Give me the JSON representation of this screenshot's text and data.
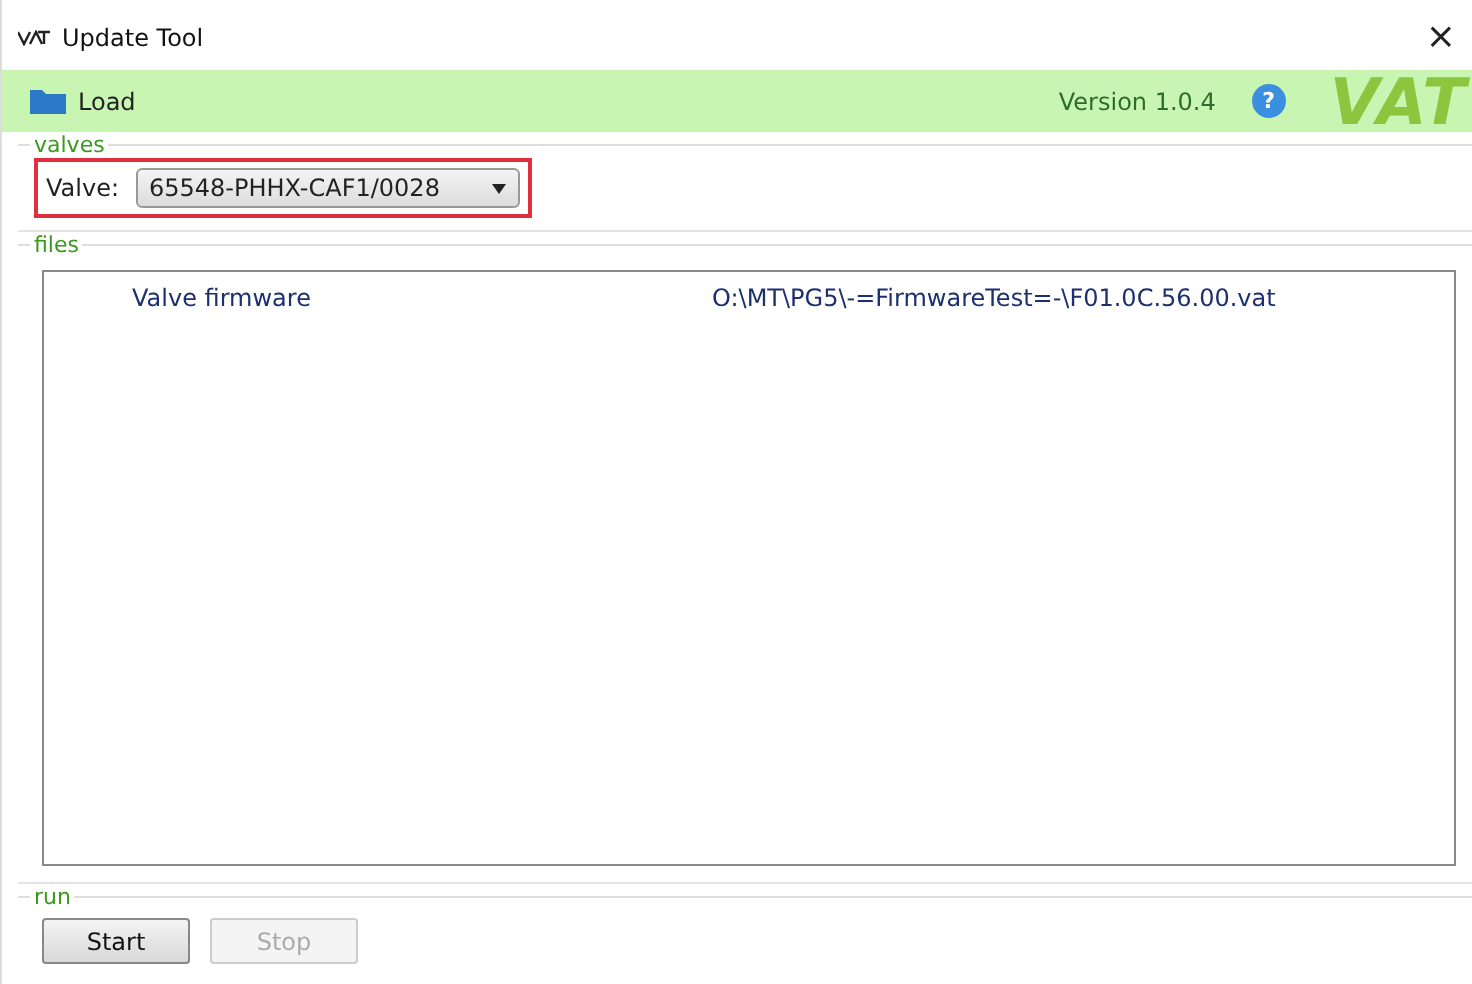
{
  "window": {
    "title": "Update Tool",
    "close": "×"
  },
  "toolbar": {
    "load": "Load",
    "version": "Version 1.0.4",
    "help": "?",
    "logo": "VAT"
  },
  "valves": {
    "legend": "valves",
    "highlighted": true,
    "label": "Valve:",
    "value": "65548-PHHX-CAF1/0028"
  },
  "files": {
    "legend": "files",
    "rows": [
      {
        "name": "Valve firmware",
        "path": "O:\\MT\\PG5\\-=FirmwareTest=-\\F01.0C.56.00.vat"
      }
    ]
  },
  "run": {
    "legend": "run",
    "buttons": [
      {
        "label": "Start",
        "disabled": false
      },
      {
        "label": "Stop",
        "disabled": true
      }
    ]
  }
}
